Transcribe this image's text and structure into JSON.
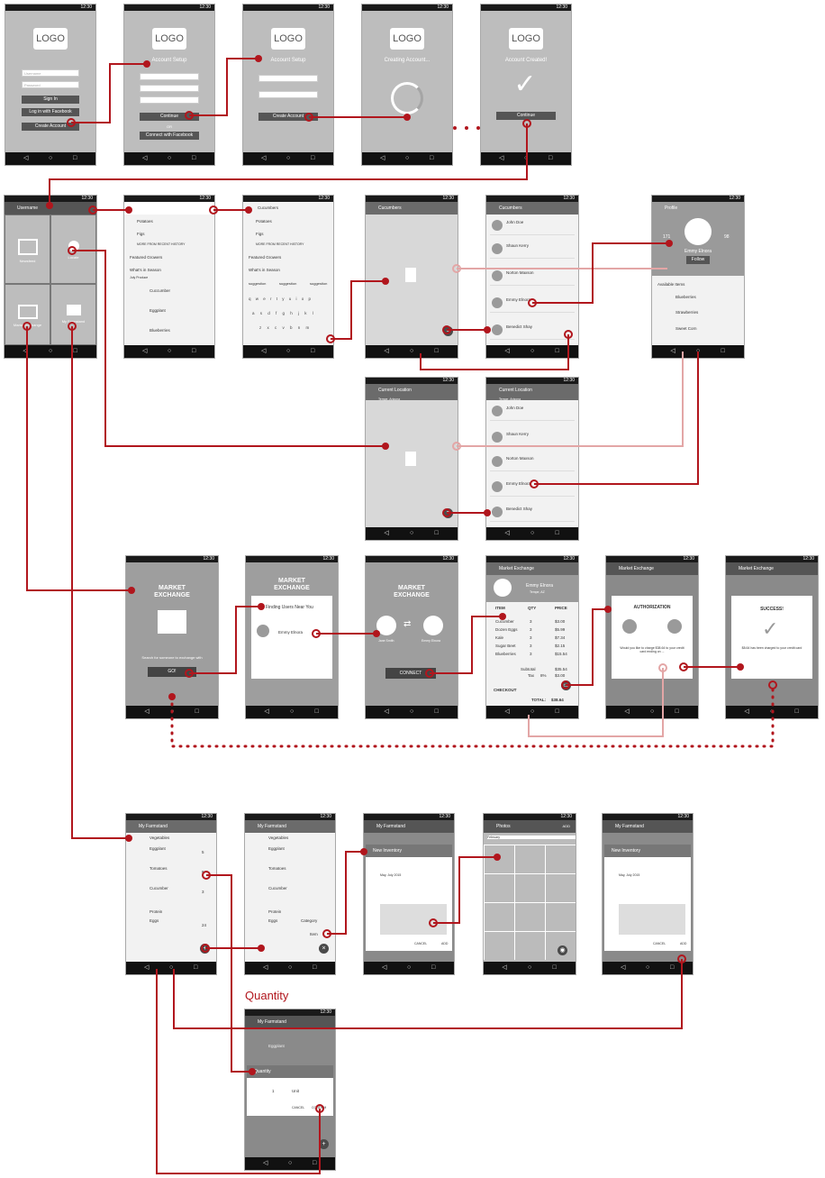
{
  "status_time": "12:30",
  "logo": "LOGO",
  "colors": {
    "connector": "#b1161d",
    "connector_light": "#e3a6a6",
    "phone": "#bdbdbd",
    "bar": "#6b6b6b"
  },
  "onboarding": {
    "login": {
      "username": "Username",
      "password": "Password",
      "sign_in": "Sign In",
      "facebook": "Log in with Facebook",
      "create": "Create Account"
    },
    "setup1": {
      "title": "Account Setup",
      "continue": "Continue",
      "or": "OR",
      "facebook": "Connect with Facebook"
    },
    "setup2": {
      "title": "Account Setup",
      "create": "Create Account"
    },
    "creating": {
      "title": "Creating Account..."
    },
    "created": {
      "title": "Account Created!",
      "continue": "Continue"
    }
  },
  "home": {
    "user": "Username",
    "tiles": [
      "Newsfeed",
      "Locate",
      "Market Exchange",
      "My Farmstand"
    ]
  },
  "search": {
    "history": [
      "Potatoes",
      "Figs"
    ],
    "history_more": "MORE FROM RECENT HISTORY",
    "featured": "Featured Growers",
    "season": "What's in Season",
    "season_sub": "July Produce",
    "items": [
      "Cuccumber",
      "Eggplant",
      "Blueberries"
    ],
    "query": "Cucumbers",
    "suggestions": [
      "suggestion",
      "suggestion",
      "suggestion"
    ],
    "kb_rows": [
      "q w e r t y u i o p",
      "a s d f g h j k l",
      "z x c v b n m"
    ]
  },
  "results": {
    "title": "Cucumbers",
    "current_location": "Current Location",
    "location_sub": "Tempe, Arizona",
    "growers": [
      "John Doe",
      "Shaun Kerry",
      "Norton Maxson",
      "Emmy Elnora",
      "Benedict Shay"
    ]
  },
  "profile": {
    "title": "Profile",
    "name": "Emmy Elnora",
    "followers": "171",
    "following": "98",
    "follow": "Follow",
    "available": "Available Items",
    "items": [
      "Blueberries",
      "Strawberries",
      "Sweet Corn"
    ]
  },
  "market": {
    "title1": "MARKET EXCHANGE",
    "search_text": "Search for someone to exchange with",
    "go": "GO!",
    "finding": "Finding Users Near You",
    "user_a": "Jane Smith",
    "user_b": "Emmy Elnora",
    "connect": "CONNECT",
    "bar_title": "Market Exchange",
    "location": "Tempe, AZ",
    "cols": [
      "ITEM",
      "QTY",
      "PRICE"
    ],
    "lines": [
      {
        "item": "Cucumber",
        "qty": "3",
        "price": "$3.00"
      },
      {
        "item": "Dozen Eggs",
        "qty": "3",
        "price": "$5.99"
      },
      {
        "item": "Kale",
        "qty": "3",
        "price": "$7.34"
      },
      {
        "item": "Sugar Beet",
        "qty": "3",
        "price": "$2.15"
      },
      {
        "item": "Blueberries",
        "qty": "3",
        "price": "$15.54"
      }
    ],
    "subtotal_label": "Subtotal",
    "subtotal": "$35.54",
    "tax_label": "Tax",
    "tax_rate": "8%",
    "tax": "$3.00",
    "checkout": "CHECKOUT",
    "total_label": "TOTAL:",
    "total": "$38.64",
    "auth_title": "AUTHORIZATION",
    "auth_text": "Would you like to charge $38.64 to your credit card ending on ...",
    "success_title": "SUCCESS!",
    "success_text": "$8.64 has been charged to your credit card"
  },
  "farmstand": {
    "title": "My Farmstand",
    "veg": "Vegetables",
    "items": [
      {
        "name": "Eggplant",
        "qty": "5"
      },
      {
        "name": "Tomatoes",
        "qty": "8"
      },
      {
        "name": "Cucumber",
        "qty": "3"
      }
    ],
    "protein": "Protein",
    "protein_item": {
      "name": "Eggs",
      "qty": "24"
    },
    "category": "Category",
    "item": "Item",
    "new_inventory": "New Inventory",
    "date": "May, July 2015",
    "cancel": "CANCEL",
    "add": "ADD",
    "photos_title": "Photos",
    "photos_sub": "February",
    "photos_add": "ADD"
  },
  "quantity": {
    "label": "Quantity",
    "dialog": "Quantity",
    "value": "1",
    "unit": "Unit",
    "cancel": "CANCEL",
    "confirm": "CONFIRM"
  }
}
